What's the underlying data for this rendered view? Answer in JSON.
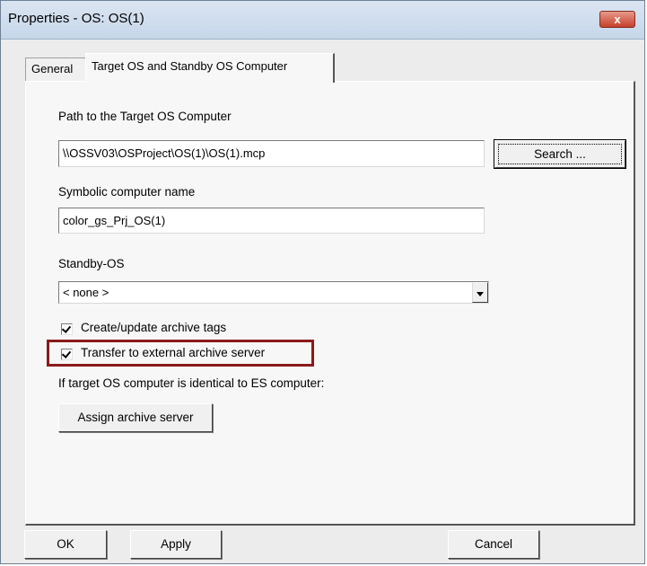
{
  "window": {
    "title": "Properties - OS: OS(1)",
    "close_glyph": "x"
  },
  "tabs": [
    {
      "label": "General"
    },
    {
      "label": "Target OS and Standby OS Computer"
    }
  ],
  "form": {
    "path_label": "Path to the Target OS Computer",
    "path_value": "\\\\OSSV03\\OSProject\\OS(1)\\OS(1).mcp",
    "search_label": "Search ...",
    "symbolic_label": "Symbolic computer name",
    "symbolic_value": "color_gs_Prj_OS(1)",
    "standby_label": "Standby-OS",
    "standby_value": "< none >",
    "checkbox_archive_tags": {
      "label": "Create/update archive tags",
      "checked": true
    },
    "checkbox_transfer": {
      "label": "Transfer to external archive server",
      "checked": true
    },
    "identical_note": "If target OS computer is identical to ES computer:",
    "assign_label": "Assign archive server"
  },
  "footer": {
    "ok_label": "OK",
    "apply_label": "Apply",
    "cancel_label": "Cancel"
  },
  "colors": {
    "highlight_border": "#8b1a1a",
    "close_button": "#c4412b"
  }
}
